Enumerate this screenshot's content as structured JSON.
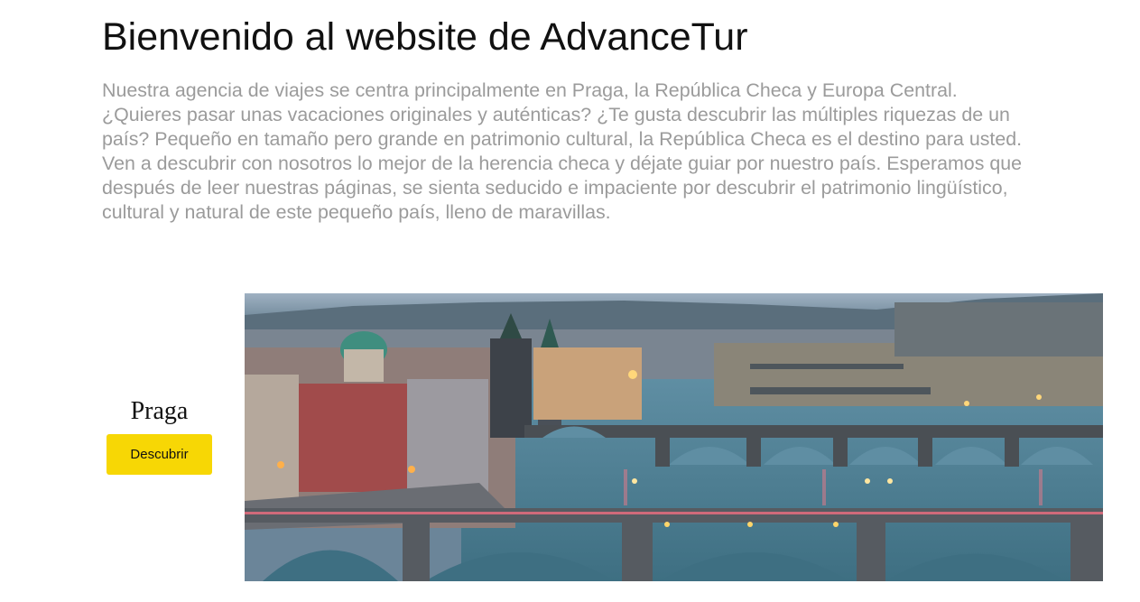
{
  "header": {
    "title": "Bienvenido al website de AdvanceTur"
  },
  "intro": {
    "lines": [
      "Nuestra agencia de viajes se centra principalmente en Praga, la República Checa y Europa Central.",
      "¿Quieres pasar unas vacaciones originales y auténticas? ¿Te gusta descubrir las múltiples riquezas de un",
      "país? Pequeño en tamaño pero grande en patrimonio cultural, la República Checa es el destino para usted.",
      "Ven a descubrir con nosotros lo mejor de la herencia checa y déjate guiar por nuestro país. Esperamos que",
      "después de leer nuestras páginas, se sienta seducido e impaciente por descubrir el patrimonio lingüístico,",
      "cultural y natural de este pequeño país, lleno de maravillas."
    ]
  },
  "destination": {
    "name": "Praga",
    "button_label": "Descubrir",
    "image_subject": "prague-bridges-photo"
  },
  "colors": {
    "button": "#f7d705",
    "intro_text": "#9b9b9b",
    "title_text": "#111111"
  }
}
